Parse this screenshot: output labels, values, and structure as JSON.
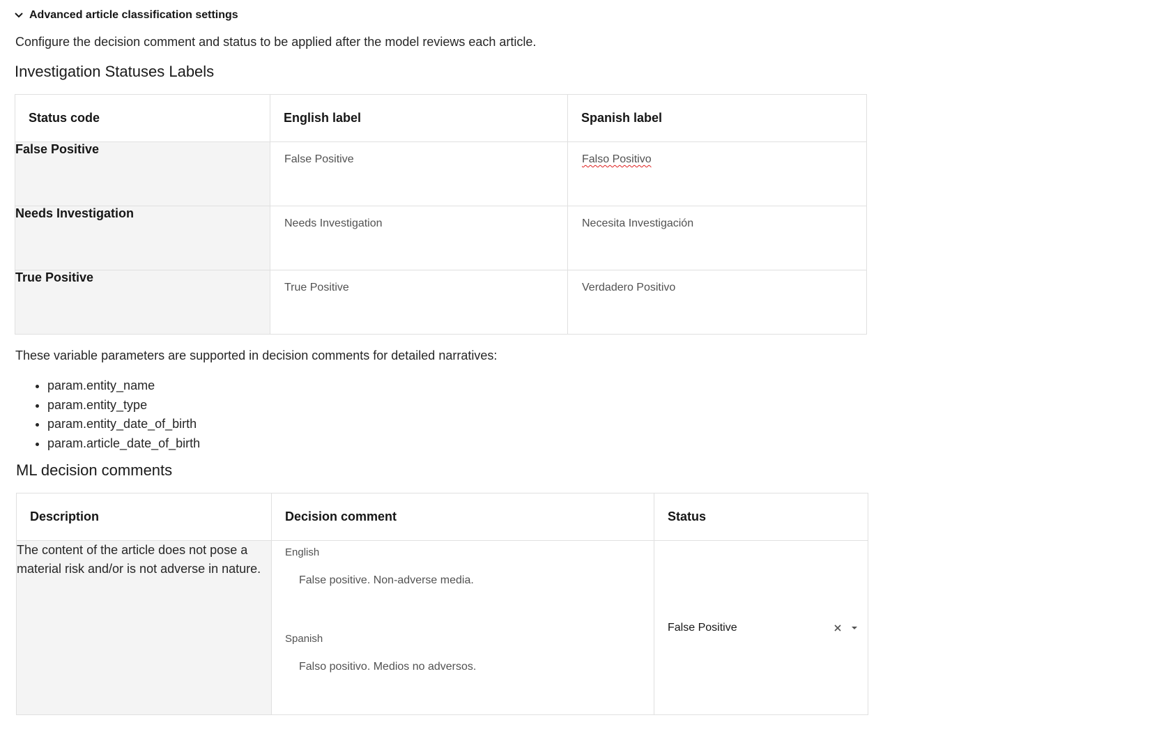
{
  "section": {
    "toggle_label": "Advanced article classification settings",
    "intro": "Configure the decision comment and status to be applied after the model reviews each article."
  },
  "statuses": {
    "heading": "Investigation Statuses Labels",
    "columns": [
      "Status code",
      "English label",
      "Spanish label"
    ],
    "rows": [
      {
        "code": "False Positive",
        "english": "False Positive",
        "spanish": "Falso Positivo"
      },
      {
        "code": "Needs Investigation",
        "english": "Needs Investigation",
        "spanish": "Necesita Investigación"
      },
      {
        "code": "True Positive",
        "english": "True Positive",
        "spanish": "Verdadero Positivo"
      }
    ]
  },
  "params": {
    "intro": "These variable parameters are supported in decision comments for detailed narratives:",
    "items": [
      "param.entity_name",
      "param.entity_type",
      "param.entity_date_of_birth",
      "param.article_date_of_birth"
    ]
  },
  "comments": {
    "heading": "ML decision comments",
    "columns": [
      "Description",
      "Decision comment",
      "Status"
    ],
    "rows": [
      {
        "description": "The content of the article does not pose a material risk and/or is not adverse in nature.",
        "english_label": "English",
        "english_comment": "False positive. Non-adverse media.",
        "spanish_label": "Spanish",
        "spanish_comment": "Falso positivo. Medios no adversos.",
        "status": "False Positive"
      }
    ]
  },
  "icons": {
    "toggle": "chevron-down-icon",
    "clear": "close-icon",
    "dropdown": "caret-down-icon"
  }
}
